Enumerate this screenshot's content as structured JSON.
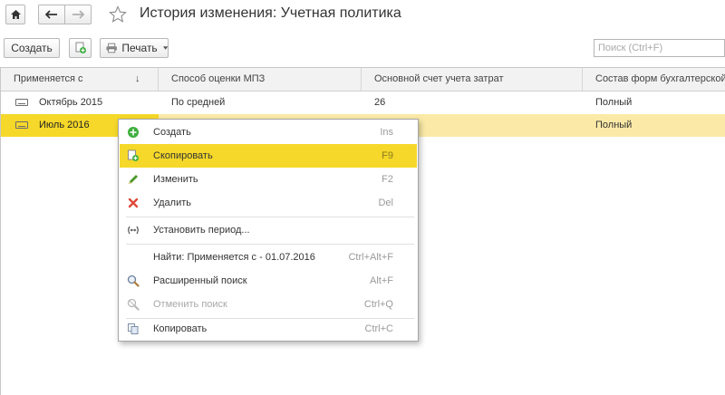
{
  "window": {
    "title": "История изменения: Учетная политика",
    "home_icon": "home-icon",
    "back_icon": "arrow-left-icon",
    "forward_icon": "arrow-right-icon",
    "favorite_icon": "star-icon"
  },
  "toolbar": {
    "create_label": "Создать",
    "copy_icon": "copy-add-icon",
    "print_label": "Печать",
    "print_icon": "printer-icon",
    "search_placeholder": "Поиск (Ctrl+F)"
  },
  "table": {
    "columns": [
      {
        "label": "Применяется с",
        "sort_icon": "↓"
      },
      {
        "label": "Способ оценки МПЗ"
      },
      {
        "label": "Основной счет учета затрат"
      },
      {
        "label": "Состав форм бухгалтерской"
      }
    ],
    "rows": [
      {
        "period": "Октябрь 2015",
        "method": "По средней",
        "account": "26",
        "forms": "Полный",
        "selected": false
      },
      {
        "period": "Июль 2016",
        "method": "",
        "account": "",
        "forms": "Полный",
        "selected": true
      }
    ]
  },
  "context_menu": {
    "items": [
      {
        "label": "Создать",
        "shortcut": "Ins",
        "icon": "plus-circle-icon"
      },
      {
        "label": "Скопировать",
        "shortcut": "F9",
        "icon": "copy-add-icon",
        "highlighted": true
      },
      {
        "label": "Изменить",
        "shortcut": "F2",
        "icon": "pencil-icon"
      },
      {
        "label": "Удалить",
        "shortcut": "Del",
        "icon": "delete-x-icon"
      },
      {
        "label": "Установить период...",
        "shortcut": "",
        "icon": "period-icon"
      },
      {
        "label": "Найти: Применяется с - 01.07.2016",
        "shortcut": "Ctrl+Alt+F",
        "icon": ""
      },
      {
        "label": "Расширенный поиск",
        "shortcut": "Alt+F",
        "icon": "magnifier-icon"
      },
      {
        "label": "Отменить поиск",
        "shortcut": "Ctrl+Q",
        "icon": "cancel-search-icon",
        "disabled": true
      },
      {
        "label": "Копировать",
        "shortcut": "Ctrl+C",
        "icon": "copy-icon"
      }
    ]
  },
  "colors": {
    "selection": "#fbeaa7",
    "highlight": "#f5d829",
    "header_bg": "#f2f2f2",
    "border": "#c8c8c8",
    "create_green": "#3fae3f",
    "delete_red": "#e04a3a"
  }
}
